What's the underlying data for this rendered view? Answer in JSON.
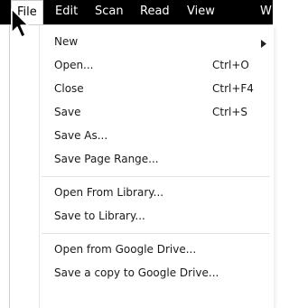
{
  "menubar": {
    "items": [
      {
        "label": "File"
      },
      {
        "label": "Edit"
      },
      {
        "label": "Scan"
      },
      {
        "label": "Read"
      },
      {
        "label": "View"
      },
      {
        "label": "W"
      }
    ]
  },
  "file_menu": {
    "items": [
      {
        "label": "New",
        "has_submenu": true
      },
      {
        "label": "Open...",
        "shortcut": "Ctrl+O"
      },
      {
        "label": "Close",
        "shortcut": "Ctrl+F4"
      },
      {
        "label": "Save",
        "shortcut": "Ctrl+S"
      },
      {
        "label": "Save As..."
      },
      {
        "label": "Save Page Range..."
      },
      {
        "label": "Open From Library..."
      },
      {
        "label": "Save to Library..."
      },
      {
        "label": "Open from Google Drive..."
      },
      {
        "label": "Save a copy to Google Drive..."
      }
    ]
  },
  "icons": {
    "submenu": "chevron-right-icon",
    "pointer": "mouse-pointer-icon"
  }
}
